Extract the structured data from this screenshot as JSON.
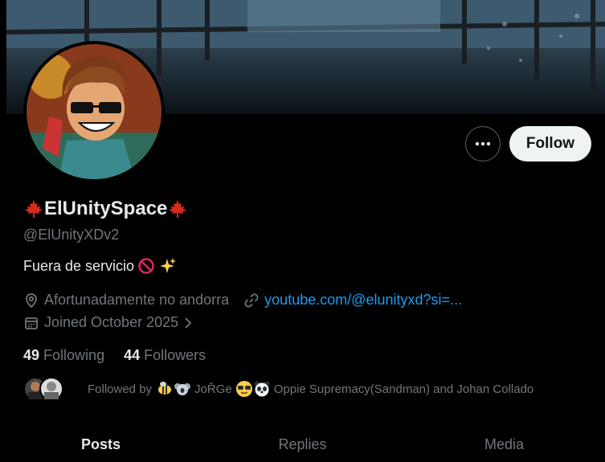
{
  "profile": {
    "display_name": "ElUnitySpace",
    "handle": "@ElUnityXDv2",
    "bio": "Fuera de servicio",
    "location": "Afortunadamente no andorra",
    "website": "youtube.com/@elunityxd?si=...",
    "joined": "Joined October 2025"
  },
  "actions": {
    "follow_label": "Follow"
  },
  "stats": {
    "following_count": "49",
    "following_label": "Following",
    "followers_count": "44",
    "followers_label": "Followers"
  },
  "followed_by": {
    "prefix": "Followed by",
    "user1": "JoŘGe",
    "text": "Oppie Supremacy(Sandman) and Johan Collado"
  },
  "tabs": [
    {
      "label": "Posts",
      "active": true
    },
    {
      "label": "Replies",
      "active": false
    },
    {
      "label": "Media",
      "active": false
    }
  ],
  "colors": {
    "accent": "#1d9bf0",
    "muted": "#71767b",
    "text": "#e7e9ea"
  }
}
